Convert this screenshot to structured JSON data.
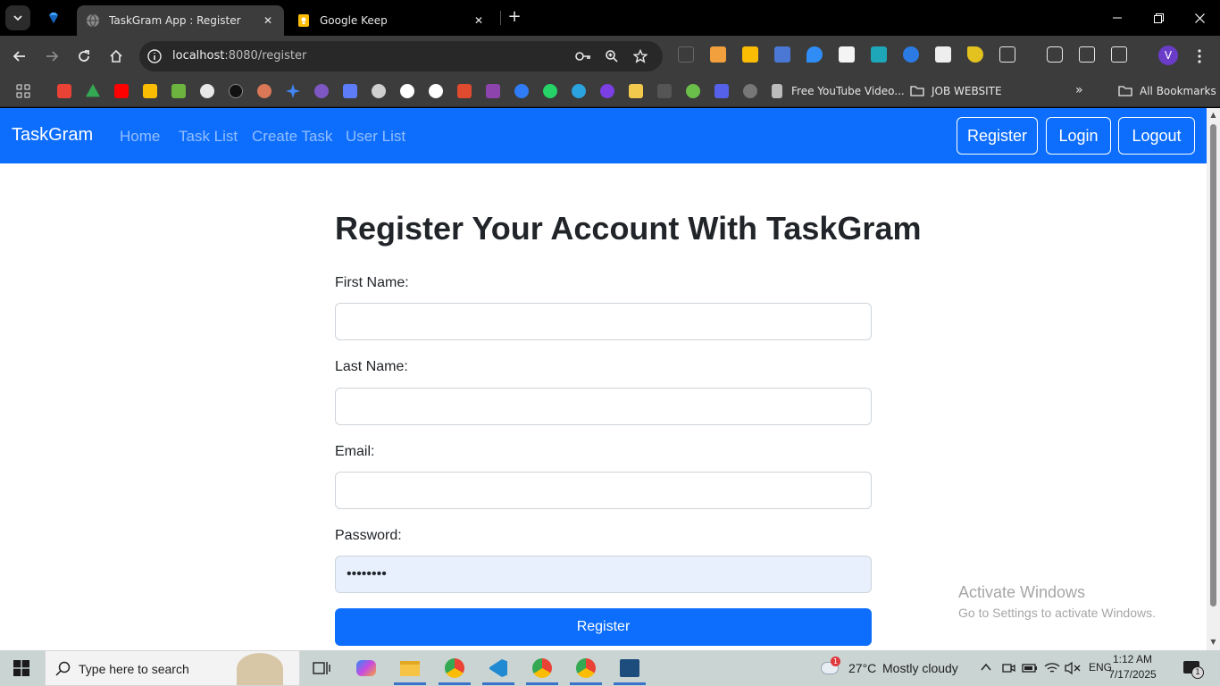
{
  "browser": {
    "tabs": [
      {
        "title": "TaskGram App : Register",
        "active": true
      },
      {
        "title": "Google Keep",
        "active": false
      }
    ],
    "address": {
      "host": "localhost",
      "rest": ":8080/register"
    },
    "bookmarks": [
      {
        "label": "Free YouTube Video..."
      },
      {
        "label": "JOB WEBSITE"
      },
      {
        "label": "All Bookmarks"
      }
    ],
    "profile_initial": "V"
  },
  "app": {
    "brand": "TaskGram",
    "nav": [
      "Home",
      "Task List",
      "Create Task",
      "User List"
    ],
    "actions": {
      "register": "Register",
      "login": "Login",
      "logout": "Logout"
    }
  },
  "form": {
    "heading": "Register Your Account With TaskGram",
    "first_name_label": "First Name:",
    "last_name_label": "Last Name:",
    "email_label": "Email:",
    "password_label": "Password:",
    "password_value": "••••••••",
    "submit_label": "Register"
  },
  "watermark": {
    "line1": "Activate Windows",
    "line2": "Go to Settings to activate Windows."
  },
  "taskbar": {
    "search_placeholder": "Type here to search",
    "weather": {
      "temp": "27°C",
      "condition": "Mostly cloudy",
      "badge": "1"
    },
    "language": "ENG",
    "time": "1:12 AM",
    "date": "7/17/2025",
    "notification_count": "1"
  },
  "colors": {
    "navbar": "#0d6efd",
    "button": "#0d6efd",
    "autofill": "#e8f0fe"
  }
}
